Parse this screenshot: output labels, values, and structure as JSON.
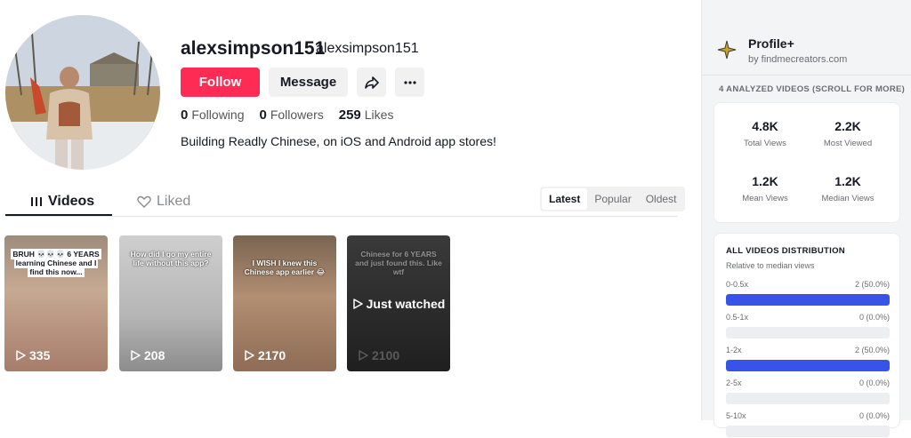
{
  "profile": {
    "username": "alexsimpson151",
    "nickname": "alexsimpson151",
    "follow_label": "Follow",
    "message_label": "Message",
    "following_count": "0",
    "following_label": "Following",
    "followers_count": "0",
    "followers_label": "Followers",
    "likes_count": "259",
    "likes_label": "Likes",
    "bio": "Building Readly Chinese, on iOS and Android app stores!"
  },
  "tabs": [
    {
      "label": "Videos"
    },
    {
      "label": "Liked"
    }
  ],
  "sort": [
    {
      "label": "Latest"
    },
    {
      "label": "Popular"
    },
    {
      "label": "Oldest"
    }
  ],
  "videos": [
    {
      "caption": "BRUH 💀💀💀 6 YEARS learning Chinese and I find this now...",
      "plays": "335"
    },
    {
      "caption": "How did I go my entire life without this app?",
      "plays": "208"
    },
    {
      "caption": "I WISH I knew this Chinese app earlier 😂",
      "plays": "2170"
    },
    {
      "caption": "Chinese for 6 YEARS and just found this. Like wtf",
      "plays": "2100",
      "overlay": "Just watched"
    }
  ],
  "sidebar": {
    "title": "Profile+",
    "subtitle": "by findmecreators.com",
    "analyzed": "4 ANALYZED VIDEOS (SCROLL FOR MORE)",
    "metrics": [
      {
        "value": "4.8K",
        "label": "Total Views"
      },
      {
        "value": "2.2K",
        "label": "Most Viewed"
      },
      {
        "value": "1.2K",
        "label": "Mean Views"
      },
      {
        "value": "1.2K",
        "label": "Median Views"
      }
    ],
    "distribution": {
      "title": "ALL VIDEOS DISTRIBUTION",
      "subtitle": "Relative to median views",
      "rows": [
        {
          "label": "0-0.5x",
          "count": "2 (50.0%)",
          "fraction": 0.5
        },
        {
          "label": "0.5-1x",
          "count": "0 (0.0%)",
          "fraction": 0
        },
        {
          "label": "1-2x",
          "count": "2 (50.0%)",
          "fraction": 0.5
        },
        {
          "label": "2-5x",
          "count": "0 (0.0%)",
          "fraction": 0
        },
        {
          "label": "5-10x",
          "count": "0 (0.0%)",
          "fraction": 0
        }
      ]
    },
    "accent_color": "#3853e8"
  },
  "colors": {
    "brand": "#fe2c55"
  },
  "icons": [
    "share-icon",
    "more-dots-icon",
    "videos-grid-icon",
    "liked-heart-icon",
    "play-icon",
    "profile-plus-icon"
  ]
}
